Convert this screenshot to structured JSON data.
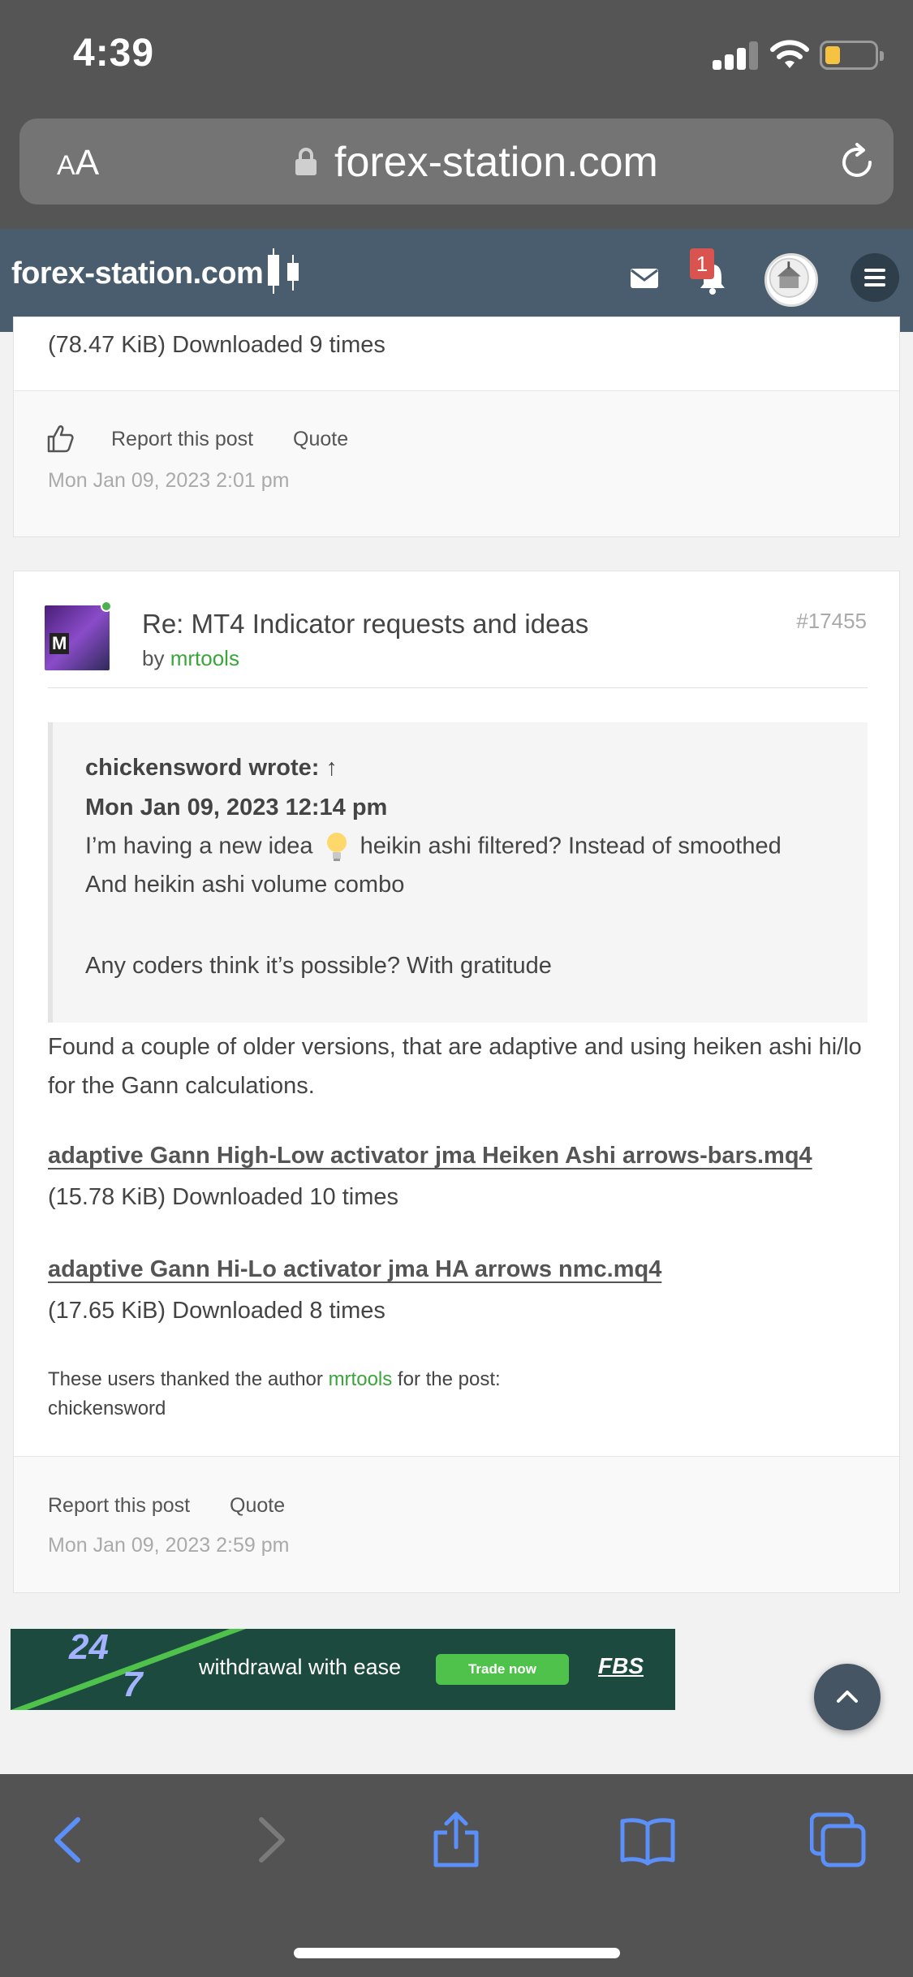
{
  "status_bar": {
    "time": "4:39"
  },
  "browser": {
    "aa_label_big": "A",
    "aa_label_small": "A",
    "url": "forex-station.com"
  },
  "site_header": {
    "logo_text": "forex-station.com",
    "notification_count": "1"
  },
  "post_prev": {
    "attachment_meta": "(78.47 KiB) Downloaded 9 times",
    "report_label": "Report this post",
    "quote_label": "Quote",
    "date": "Mon Jan 09, 2023 2:01 pm"
  },
  "post_main": {
    "title": "Re: MT4 Indicator requests and ideas",
    "author_prefix": "by",
    "author": "mrtools",
    "number": "#17455",
    "quote": {
      "cite": "chickensword wrote: ↑",
      "date": "Mon Jan 09, 2023 12:14 pm",
      "line1_a": "I’m having a new idea",
      "line1_b": "heikin ashi filtered? Instead of smoothed",
      "line2": "And heikin ashi volume combo",
      "line3": "Any coders think it’s possible? With gratitude"
    },
    "body": "Found a couple of older versions, that are adaptive and using heiken ashi hi/lo for the Gann calculations.",
    "attachments": [
      {
        "name": "adaptive Gann High-Low activator jma Heiken Ashi arrows-bars.mq4",
        "meta": "(15.78 KiB) Downloaded 10 times"
      },
      {
        "name": "adaptive Gann Hi-Lo activator jma HA arrows nmc.mq4",
        "meta": "(17.65 KiB) Downloaded 8 times"
      }
    ],
    "thanks_prefix": "These users thanked the author",
    "thanks_author": "mrtools",
    "thanks_suffix": "for the post:",
    "thanked_by": "chickensword",
    "report_label": "Report this post",
    "quote_label": "Quote",
    "date": "Mon Jan 09, 2023 2:59 pm"
  },
  "ad": {
    "big_24": "24",
    "big_7": "7",
    "text": "withdrawal with ease",
    "cta": "Trade now",
    "brand": "FBS"
  },
  "colors": {
    "header_bg": "#4a5d6e",
    "link_green": "#3aa53a",
    "badge_red": "#d9534f",
    "toolbar_blue": "#5b8ff9"
  },
  "icons": [
    "lock-icon",
    "reload-icon",
    "mail-icon",
    "bell-icon",
    "menu-icon",
    "thumbs-up-icon",
    "lightbulb-icon",
    "chevron-up-icon",
    "back-icon",
    "forward-icon",
    "share-icon",
    "bookmarks-icon",
    "tabs-icon"
  ]
}
